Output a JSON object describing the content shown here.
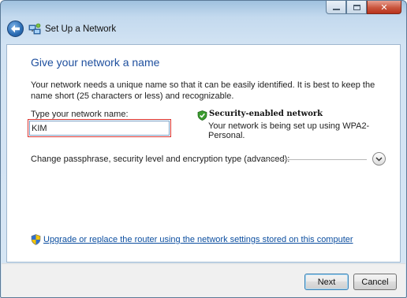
{
  "window": {
    "title": "Set Up a Network",
    "colors": {
      "heading": "#1e4f9e",
      "link": "#0d4fa0",
      "highlight_border": "#d9332f"
    }
  },
  "icons": {
    "back": "back-arrow-icon",
    "title": "network-setup-icon",
    "security": "green-check-shield-icon",
    "uac": "uac-shield-icon",
    "expand": "chevron-down-icon"
  },
  "main": {
    "heading": "Give your network a name",
    "description": "Your network needs a unique name so that it can be easily identified. It is best to keep the name short (25 characters or less) and recognizable.",
    "field_label": "Type your network name:",
    "field_value": "KIM",
    "security": {
      "title": "Security-enabled network",
      "description": "Your network is being set up using WPA2-Personal."
    },
    "advanced_label": "Change passphrase, security level and encryption type (advanced):",
    "router_link": "Upgrade or replace the router using the network settings stored on this computer"
  },
  "footer": {
    "next_label": "Next",
    "cancel_label": "Cancel"
  }
}
